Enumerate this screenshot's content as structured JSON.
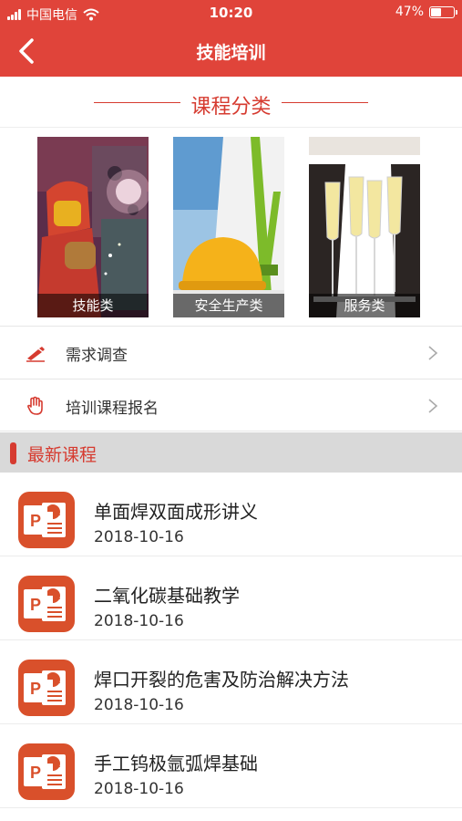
{
  "status_bar": {
    "carrier": "中国电信",
    "time": "10:20",
    "battery_percent": "47%",
    "battery_level": 0.47
  },
  "nav": {
    "title": "技能培训",
    "back_icon": "chevron-left-icon"
  },
  "categories_section": {
    "title": "课程分类",
    "items": [
      {
        "label": "技能类",
        "image": "welding-worker-image"
      },
      {
        "label": "安全生产类",
        "image": "safety-worker-hardhat-image"
      },
      {
        "label": "服务类",
        "image": "waiter-champagne-image"
      }
    ]
  },
  "menu": [
    {
      "label": "需求调查",
      "icon": "pen-icon"
    },
    {
      "label": "培训课程报名",
      "icon": "hand-icon"
    }
  ],
  "latest_section": {
    "title": "最新课程",
    "courses": [
      {
        "title": "单面焊双面成形讲义",
        "date": "2018-10-16",
        "icon": "powerpoint-icon"
      },
      {
        "title": "二氧化碳基础教学",
        "date": "2018-10-16",
        "icon": "powerpoint-icon"
      },
      {
        "title": "焊口开裂的危害及防治解决方法",
        "date": "2018-10-16",
        "icon": "powerpoint-icon"
      },
      {
        "title": "手工钨极氩弧焊基础",
        "date": "2018-10-16",
        "icon": "powerpoint-icon"
      }
    ]
  },
  "colors": {
    "brand_red": "#e0443a",
    "accent_red": "#d63b30",
    "ppt_orange": "#d9502b",
    "section_gray": "#d9d9d9"
  }
}
